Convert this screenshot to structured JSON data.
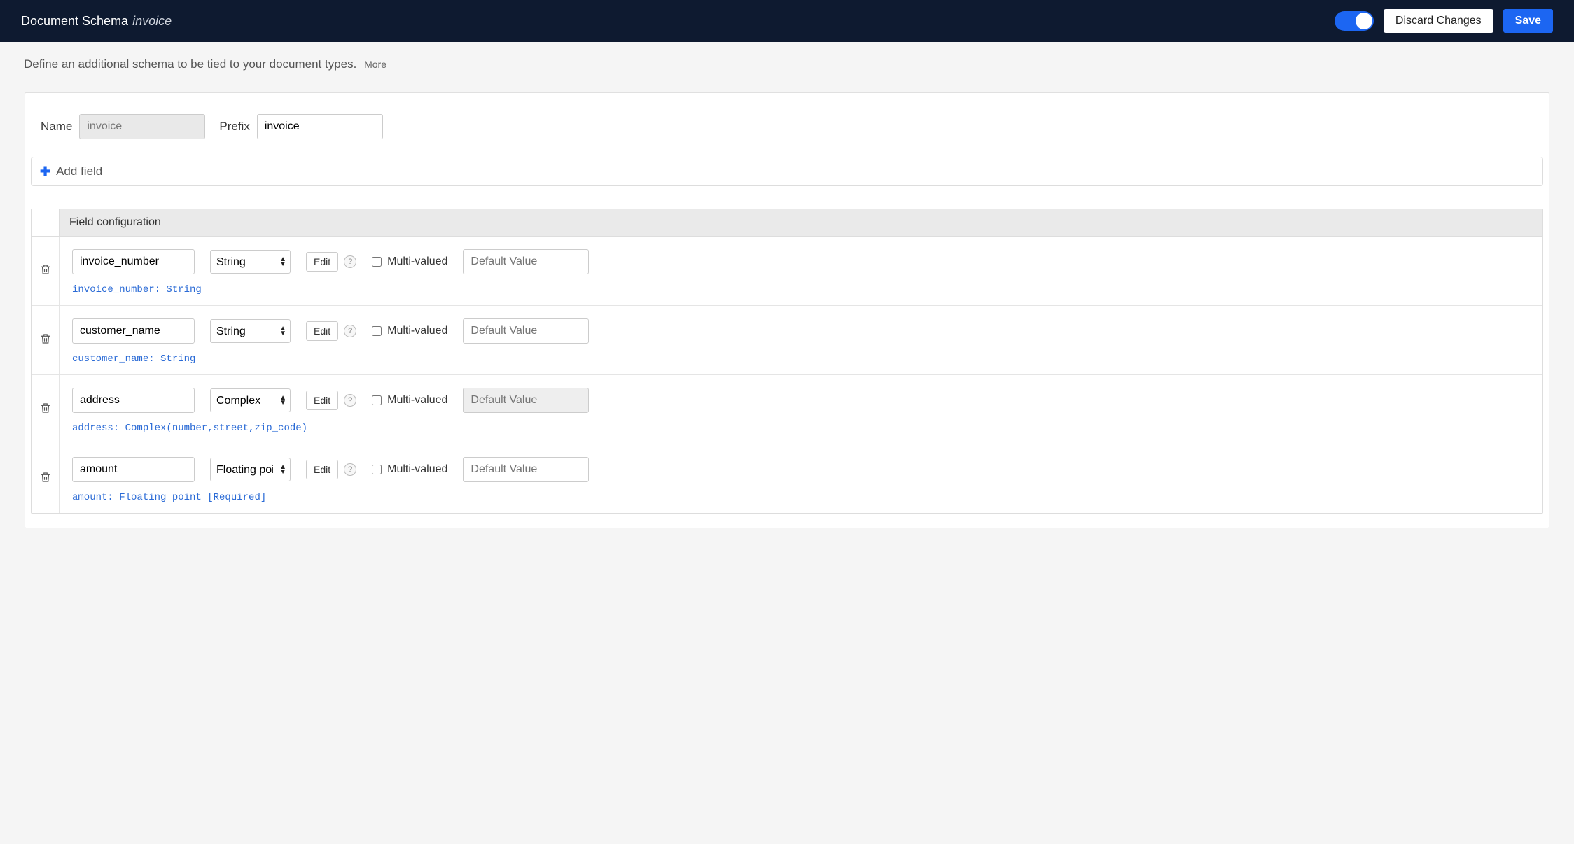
{
  "header": {
    "title_prefix": "Document Schema",
    "schema_name": "invoice",
    "discard_label": "Discard Changes",
    "save_label": "Save"
  },
  "description": {
    "text": "Define an additional schema to be tied to your document types.",
    "more_label": "More"
  },
  "schema_form": {
    "name_label": "Name",
    "name_value": "invoice",
    "prefix_label": "Prefix",
    "prefix_value": "invoice"
  },
  "add_field_label": "Add field",
  "field_table_header": "Field configuration",
  "common": {
    "edit_label": "Edit",
    "help_glyph": "?",
    "multi_valued_label": "Multi-valued",
    "default_placeholder": "Default Value"
  },
  "fields": [
    {
      "name": "invoice_number",
      "type": "String",
      "multi": false,
      "default_disabled": false,
      "signature": "invoice_number: String"
    },
    {
      "name": "customer_name",
      "type": "String",
      "multi": false,
      "default_disabled": false,
      "signature": "customer_name: String"
    },
    {
      "name": "address",
      "type": "Complex",
      "multi": false,
      "default_disabled": true,
      "signature": "address: Complex(number,street,zip_code)"
    },
    {
      "name": "amount",
      "type": "Floating poi",
      "multi": false,
      "default_disabled": false,
      "signature": "amount: Floating point [Required]"
    }
  ]
}
